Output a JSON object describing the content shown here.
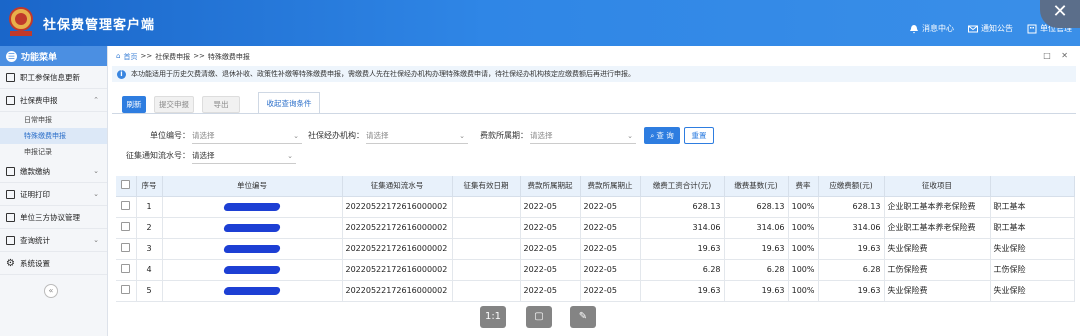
{
  "header": {
    "app_title": "社保费管理客户端",
    "links": [
      {
        "label": "消息中心",
        "icon": "bell-icon"
      },
      {
        "label": "通知公告",
        "icon": "mail-icon"
      },
      {
        "label": "单位管理",
        "icon": "building-icon"
      }
    ],
    "close_glyph": "✕"
  },
  "sidebar": {
    "title": "功能菜单",
    "items": [
      {
        "label": "职工参保信息更新"
      },
      {
        "label": "社保费申报",
        "expanded": true,
        "children": [
          {
            "label": "日常申报"
          },
          {
            "label": "特殊缴费申报",
            "active": true
          },
          {
            "label": "申报记录"
          }
        ]
      },
      {
        "label": "缴款缴纳"
      },
      {
        "label": "证明打印"
      },
      {
        "label": "单位三方协议管理"
      },
      {
        "label": "查询统计"
      },
      {
        "label": "系统设置"
      }
    ],
    "collapse_glyph": "«"
  },
  "breadcrumb": {
    "home": "首页",
    "sep": ">>",
    "level1": "社保费申报",
    "level2": "特殊缴费申报"
  },
  "tab_controls": "□ ✕",
  "notice": "本功能适用于历史欠费清缴、退休补收、政策性补缴等特殊缴费申报，需缴费人先在社保经办机构办理特殊缴费申请，待社保经办机构核定应缴费额后再进行申报。",
  "toolbar": {
    "refresh": "刷新",
    "submit": "提交申报",
    "export": "导出",
    "filter_tab": "收起查询条件"
  },
  "filters": {
    "unit_no_label": "单位编号：",
    "unit_no_value": "请选择",
    "agency_label": "社保经办机构：",
    "agency_value": "请选择",
    "period_label": "费款所属期：",
    "period_value": "请选择",
    "query": "查 询",
    "reset": "重置",
    "serial_label": "征集通知流水号：",
    "serial_value": "请选择"
  },
  "table": {
    "headers": [
      "",
      "序号",
      "单位编号",
      "征集通知流水号",
      "征集有效日期",
      "费款所属期起",
      "费款所属期止",
      "缴费工资合计(元)",
      "缴费基数(元)",
      "费率",
      "应缴费额(元)",
      "征收项目",
      ""
    ],
    "rows": [
      {
        "no": "1",
        "serial": "20220522172616000002",
        "valid": "",
        "start": "2022-05",
        "end": "2022-05",
        "wage": "628.13",
        "base": "628.13",
        "rate": "100%",
        "due": "628.13",
        "item": "企业职工基本养老保险费",
        "extra": "职工基本"
      },
      {
        "no": "2",
        "serial": "20220522172616000002",
        "valid": "",
        "start": "2022-05",
        "end": "2022-05",
        "wage": "314.06",
        "base": "314.06",
        "rate": "100%",
        "due": "314.06",
        "item": "企业职工基本养老保险费",
        "extra": "职工基本"
      },
      {
        "no": "3",
        "serial": "20220522172616000002",
        "valid": "",
        "start": "2022-05",
        "end": "2022-05",
        "wage": "19.63",
        "base": "19.63",
        "rate": "100%",
        "due": "19.63",
        "item": "失业保险费",
        "extra": "失业保险"
      },
      {
        "no": "4",
        "serial": "20220522172616000002",
        "valid": "",
        "start": "2022-05",
        "end": "2022-05",
        "wage": "6.28",
        "base": "6.28",
        "rate": "100%",
        "due": "6.28",
        "item": "工伤保险费",
        "extra": "工伤保险"
      },
      {
        "no": "5",
        "serial": "20220522172616000002",
        "valid": "",
        "start": "2022-05",
        "end": "2022-05",
        "wage": "19.63",
        "base": "19.63",
        "rate": "100%",
        "due": "19.63",
        "item": "失业保险费",
        "extra": "失业保险"
      }
    ]
  },
  "floatbar": {
    "actual_size": "1:1",
    "fit": "▢",
    "edit": "✎"
  }
}
